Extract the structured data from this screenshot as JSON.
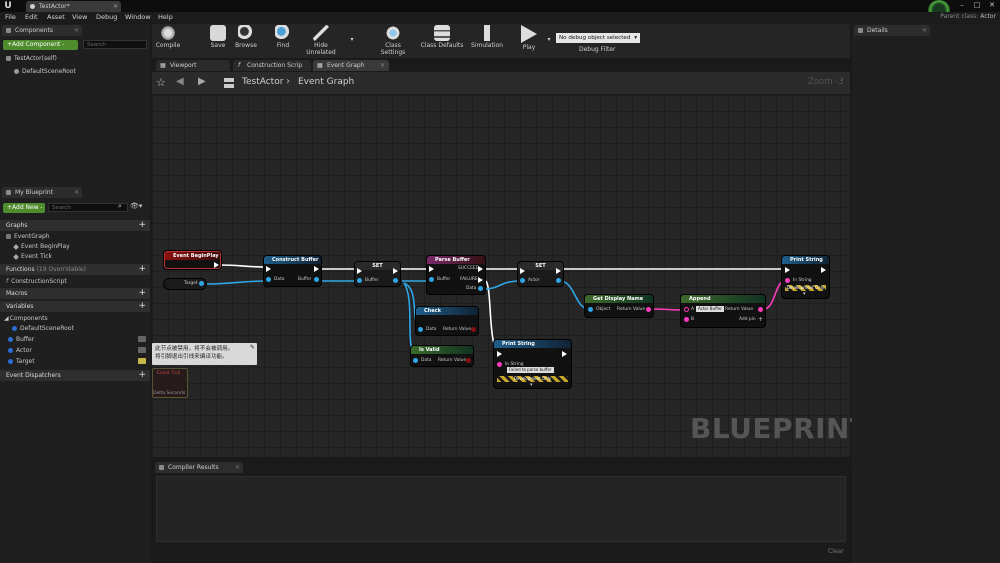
{
  "window": {
    "tab_title": "TestActor*",
    "parent_class_label": "Parent class:",
    "parent_class_value": "Actor"
  },
  "menu": [
    "File",
    "Edit",
    "Asset",
    "View",
    "Debug",
    "Window",
    "Help"
  ],
  "components_panel": {
    "tab": "Components",
    "add_button": "+Add Component -",
    "search_placeholder": "Search",
    "tree": [
      "TestActor(self)",
      "DefaultSceneRoot"
    ]
  },
  "my_blueprint": {
    "tab": "My Blueprint",
    "add_new": "+Add New -",
    "search_placeholder": "Search",
    "graphs_label": "Graphs",
    "event_graph": "EventGraph",
    "events": [
      "Event BeginPlay",
      "Event Tick"
    ],
    "functions_label": "Functions",
    "functions_count": "(19 Overridable)",
    "functions": [
      "ConstructionScript"
    ],
    "macros_label": "Macros",
    "variables_label": "Variables",
    "components_label": "Components",
    "component_vars": [
      "DefaultSceneRoot"
    ],
    "variables": [
      {
        "name": "Buffer",
        "color": "#2a6fd6"
      },
      {
        "name": "Actor",
        "color": "#2a6fd6"
      },
      {
        "name": "Target",
        "color": "#2a6fd6"
      }
    ],
    "dispatchers_label": "Event Dispatchers"
  },
  "toolbar": {
    "compile": "Compile",
    "save": "Save",
    "browse": "Browse",
    "find": "Find",
    "hide_unrelated": "Hide Unrelated",
    "class_settings": "Class Settings",
    "class_defaults": "Class Defaults",
    "simulation": "Simulation",
    "play": "Play",
    "debug_select": "No debug object selected",
    "debug_filter": "Debug Filter"
  },
  "editor_tabs": [
    "Viewport",
    "Construction Scrip",
    "Event Graph"
  ],
  "graph_header": {
    "actor": "TestActor",
    "graph": "Event Graph",
    "zoom": "Zoom -3"
  },
  "graph": {
    "watermark": "BLUEPRINT",
    "nodes": {
      "begin_play": "Event BeginPlay",
      "target": "Target",
      "construct_buffer": {
        "title": "Construct Buffer",
        "pin_data": "Data",
        "pin_buffer": "Buffer"
      },
      "set1": {
        "title": "SET",
        "pin": "Buffer"
      },
      "parse_buffer": {
        "title": "Parse Buffer",
        "pin_buffer": "Buffer",
        "succeed": "SUCCEED",
        "failed": "FAILURE",
        "data": "Data"
      },
      "set2": {
        "title": "SET",
        "pin": "Actor"
      },
      "check": {
        "title": "Check",
        "pin_data": "Data",
        "ret": "Return Value"
      },
      "is_valid": {
        "title": "Is Valid",
        "pin_data": "Data",
        "ret": "Return Value"
      },
      "print_fail": {
        "title": "Print String",
        "in_string": "In String",
        "value": "Failed to parse buffer",
        "dev": "Development Only"
      },
      "get_display_name": {
        "title": "Get Display Name",
        "object": "Object",
        "ret": "Return Value"
      },
      "append": {
        "title": "Append",
        "a": "A",
        "a_value": "Actor Buffer",
        "b": "B",
        "ret": "Return Value",
        "add_pin": "Add pin"
      },
      "print_string": {
        "title": "Print String",
        "in_string": "In String",
        "dev": "Development Only"
      }
    }
  },
  "tooltip": {
    "line1": "此节点被禁用，将不会被调用。",
    "line2": "将引脚退出引线来编译功能。"
  },
  "ghost_node": {
    "title": "Event Tick",
    "sub": "Delta Seconds"
  },
  "compiler": {
    "tab": "Compiler Results",
    "clear": "Clear"
  },
  "details": {
    "tab": "Details"
  },
  "colors": {
    "exec": "#ffffff",
    "object_pin": "#2fa6e6",
    "string_pin": "#ff3cbf",
    "accent_green": "#4e8c2e"
  }
}
